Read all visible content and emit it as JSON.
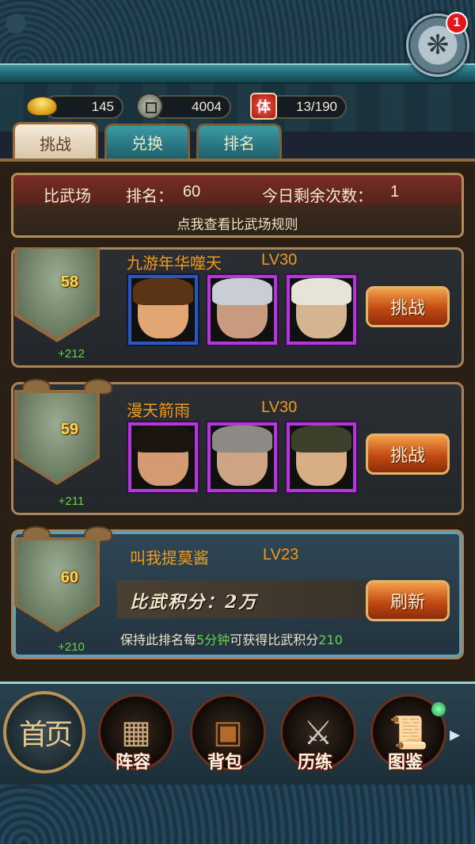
{
  "resources": {
    "gold": {
      "icon": "gold-ingot-icon",
      "value": "145"
    },
    "coins": {
      "icon": "copper-coin-icon",
      "value": "4004"
    },
    "stamina": {
      "icon": "stamina-icon",
      "glyph": "体",
      "value": "13/190"
    }
  },
  "notification": {
    "count": "1"
  },
  "tabs": [
    {
      "label": "挑战",
      "active": true
    },
    {
      "label": "兑换",
      "active": false
    },
    {
      "label": "排名",
      "active": false
    }
  ],
  "arena_info": {
    "title": "比武场",
    "rank_label": "排名：",
    "rank_value": "60",
    "remaining_label": "今日剩余次数：",
    "remaining_value": "1",
    "rules_link": "点我查看比武场规则"
  },
  "opponents": [
    {
      "rank": "58",
      "gain": "+212",
      "name": "九游年华噬天",
      "level": "LV30",
      "button": "挑战"
    },
    {
      "rank": "59",
      "gain": "+211",
      "name": "漫天箭雨",
      "level": "LV30",
      "button": "挑战"
    }
  ],
  "me": {
    "rank": "60",
    "gain": "+210",
    "name": "叫我提莫酱",
    "level": "LV23",
    "score_text": "比武积分：2万",
    "button": "刷新",
    "hold_prefix": "保持此排名每",
    "hold_time": "5分钟",
    "hold_middle": "可获得比武积分",
    "hold_points": "210"
  },
  "nav": {
    "home": "首页",
    "items": [
      {
        "label": "阵容",
        "icon": "formation-icon"
      },
      {
        "label": "背包",
        "icon": "backpack-icon"
      },
      {
        "label": "历练",
        "icon": "swords-icon"
      },
      {
        "label": "图鉴",
        "icon": "scroll-icon"
      }
    ]
  },
  "colors": {
    "accent_orange": "#f29a1a",
    "gain_green": "#69d14b",
    "rank_gold": "#ffd34a",
    "teal": "#3b8e9c"
  }
}
